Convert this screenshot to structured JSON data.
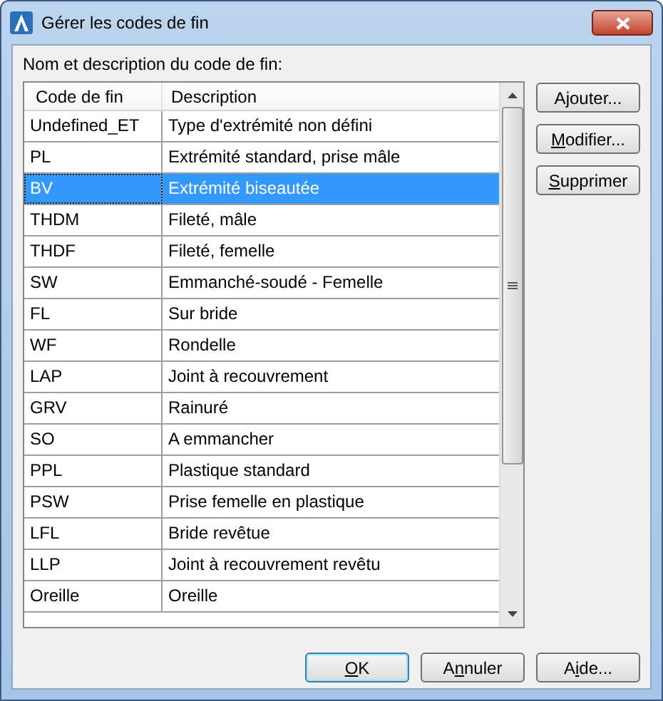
{
  "window": {
    "title": "Gérer les codes de fin"
  },
  "list_label": "Nom et description du code de fin:",
  "table": {
    "columns": [
      "Code de fin",
      "Description"
    ],
    "rows": [
      {
        "code": "Undefined_ET",
        "description": "Type d'extrémité non défini",
        "selected": false
      },
      {
        "code": "PL",
        "description": "Extrémité standard, prise mâle",
        "selected": false
      },
      {
        "code": "BV",
        "description": "Extrémité biseautée",
        "selected": true
      },
      {
        "code": "THDM",
        "description": "Fileté, mâle",
        "selected": false
      },
      {
        "code": "THDF",
        "description": "Fileté, femelle",
        "selected": false
      },
      {
        "code": "SW",
        "description": "Emmanché-soudé - Femelle",
        "selected": false
      },
      {
        "code": "FL",
        "description": "Sur bride",
        "selected": false
      },
      {
        "code": "WF",
        "description": "Rondelle",
        "selected": false
      },
      {
        "code": "LAP",
        "description": "Joint à recouvrement",
        "selected": false
      },
      {
        "code": "GRV",
        "description": "Rainuré",
        "selected": false
      },
      {
        "code": "SO",
        "description": "A emmancher",
        "selected": false
      },
      {
        "code": "PPL",
        "description": "Plastique standard",
        "selected": false
      },
      {
        "code": "PSW",
        "description": "Prise femelle en plastique",
        "selected": false
      },
      {
        "code": "LFL",
        "description": "Bride revêtue",
        "selected": false
      },
      {
        "code": "LLP",
        "description": "Joint à recouvrement revêtu",
        "selected": false
      },
      {
        "code": "Oreille",
        "description": "Oreille",
        "selected": false
      }
    ]
  },
  "side_buttons": [
    {
      "before": "A",
      "access_key": "j",
      "after": "outer..."
    },
    {
      "access_key": "M",
      "after": "odifier..."
    },
    {
      "access_key": "S",
      "after": "upprimer"
    }
  ],
  "bottom_buttons": [
    {
      "access_key": "O",
      "after": "K",
      "default": true
    },
    {
      "before": "A",
      "access_key": "n",
      "after": "nuler",
      "default": false
    },
    {
      "before": "A",
      "access_key": "i",
      "after": "de...",
      "default": false
    }
  ]
}
